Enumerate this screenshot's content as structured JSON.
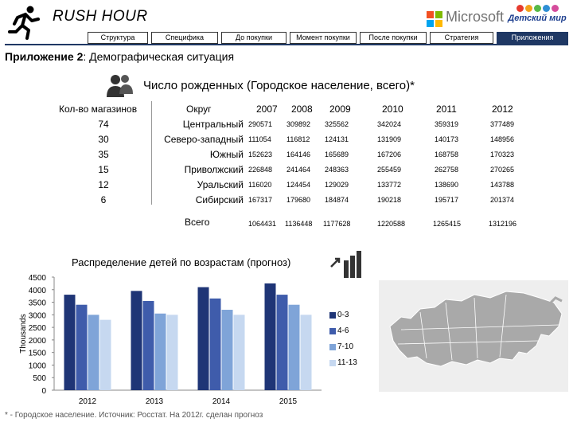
{
  "header": {
    "brand": "RUSH HOUR",
    "ms_text": "Microsoft",
    "partner_name": "Детский мир",
    "nav_tabs": [
      {
        "label": "Структура"
      },
      {
        "label": "Специфика"
      },
      {
        "label": "До покупки"
      },
      {
        "label": "Момент покупки"
      },
      {
        "label": "После покупки"
      },
      {
        "label": "Стратегия"
      },
      {
        "label": "Приложения",
        "active": true
      }
    ],
    "icons": [
      "runner-logo-icon",
      "microsoft-logo-icon",
      "detsky-mir-logo-icon"
    ]
  },
  "section": {
    "title_bold": "Приложение 2",
    "title_rest": ": Демографическая ситуация"
  },
  "demographics": {
    "title": "Число рожденных (Городское население, всего)*",
    "stores_header": "Кол-во магазинов",
    "district_header": "Округ",
    "years": [
      "2007",
      "2008",
      "2009",
      "2010",
      "2011",
      "2012"
    ],
    "rows": [
      {
        "stores": "74",
        "district": "Центральный",
        "values": [
          "290571",
          "309892",
          "325562",
          "342024",
          "359319",
          "377489"
        ]
      },
      {
        "stores": "30",
        "district": "Северо-западный",
        "values": [
          "111054",
          "116812",
          "124131",
          "131909",
          "140173",
          "148956"
        ]
      },
      {
        "stores": "35",
        "district": "Южный",
        "values": [
          "152623",
          "164146",
          "165689",
          "167206",
          "168758",
          "170323"
        ]
      },
      {
        "stores": "15",
        "district": "Приволжский",
        "values": [
          "226848",
          "241464",
          "248363",
          "255459",
          "262758",
          "270265"
        ]
      },
      {
        "stores": "12",
        "district": "Уральский",
        "values": [
          "116020",
          "124454",
          "129029",
          "133772",
          "138690",
          "143788"
        ]
      },
      {
        "stores": "6",
        "district": "Сибирский",
        "values": [
          "167317",
          "179680",
          "184874",
          "190218",
          "195717",
          "201374"
        ]
      }
    ],
    "total_label": "Всего",
    "totals": [
      "1064431",
      "1136448",
      "1177628",
      "1220588",
      "1265415",
      "1312196"
    ]
  },
  "chart_data": {
    "type": "bar",
    "title": "Распределение детей по возрастам (прогноз)",
    "ylabel": "Thousands",
    "categories": [
      "2012",
      "2013",
      "2014",
      "2015"
    ],
    "ylim": [
      0,
      4500
    ],
    "yticks": [
      "0",
      "500",
      "1000",
      "1500",
      "2000",
      "2500",
      "3000",
      "3500",
      "4000",
      "4500"
    ],
    "grid": false,
    "legend_position": "right",
    "series": [
      {
        "name": "0-3",
        "values": [
          3800,
          3950,
          4100,
          4250
        ],
        "color": "#1f3576"
      },
      {
        "name": "4-6",
        "values": [
          3400,
          3550,
          3650,
          3800
        ],
        "color": "#3f5cab"
      },
      {
        "name": "7-10",
        "values": [
          3000,
          3050,
          3200,
          3400
        ],
        "color": "#7fa4d8"
      },
      {
        "name": "11-13",
        "values": [
          2800,
          3000,
          3000,
          3000
        ],
        "color": "#c6d8f0"
      }
    ]
  },
  "map": {
    "icon": "russia-map-icon"
  },
  "footnote": "* - Городское население. Источник: Росстат. На 2012г. сделан прогноз"
}
